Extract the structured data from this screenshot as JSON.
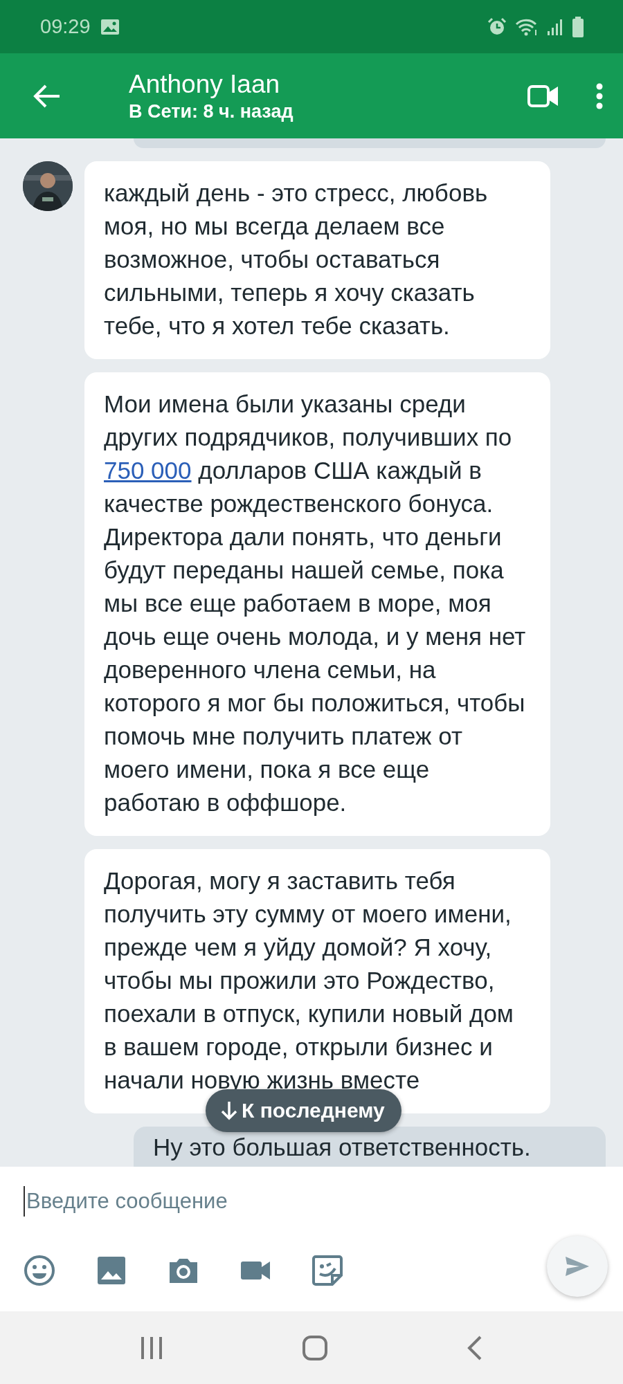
{
  "status_bar": {
    "time": "09:29"
  },
  "header": {
    "title": "Anthony Iaan",
    "subtitle": "В Сети: 8 ч. назад"
  },
  "messages": [
    {
      "kind": "incoming",
      "show_avatar": true,
      "parts": [
        {
          "kind": "text",
          "text": "каждый день - это стресс, любовь моя, но мы всегда делаем все возможное, чтобы оставаться сильными, теперь я хочу сказать тебе, что я хотел тебе сказать."
        }
      ]
    },
    {
      "kind": "incoming",
      "show_avatar": false,
      "parts": [
        {
          "kind": "text",
          "text": "Мои имена были указаны среди других подрядчиков, получивших по "
        },
        {
          "kind": "link",
          "text": "750 000"
        },
        {
          "kind": "text",
          "text": " долларов США каждый в качестве рождественского бонуса. Директора дали понять, что деньги будут переданы нашей семье, пока мы все еще работаем в море, моя дочь еще очень молода, и у меня нет доверенного члена семьи, на которого я мог бы положиться, чтобы помочь мне получить платеж от моего имени, пока я все еще работаю в оффшоре."
        }
      ]
    },
    {
      "kind": "incoming",
      "show_avatar": false,
      "parts": [
        {
          "kind": "text",
          "text": "Дорогая, могу я заставить тебя получить эту сумму от моего имени, прежде чем я уйду домой? Я хочу, чтобы мы прожили это Рождество, поехали в отпуск, купили новый дом в вашем городе, открыли бизнес и начали новую жизнь вместе"
        }
      ]
    },
    {
      "kind": "outgoing",
      "parts": [
        {
          "kind": "text",
          "text": "Ну это большая ответственность."
        }
      ]
    }
  ],
  "jump_button": {
    "label": "К последнему"
  },
  "composer": {
    "placeholder": "Введите сообщение"
  }
}
